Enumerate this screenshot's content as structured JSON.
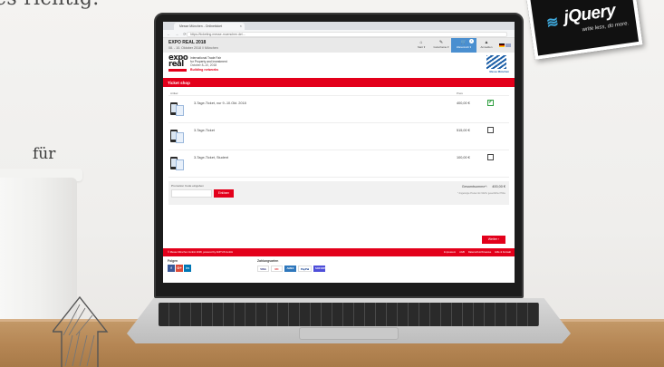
{
  "background": {
    "headline_fragment": "es richtig.",
    "word_fragment": "für"
  },
  "sticker": {
    "name": "jQuery",
    "tagline": "write less, do more."
  },
  "browser": {
    "tab_title": "Messe München - Onlineticket",
    "tab_close": "×",
    "nav_buttons": "← → ⟳ ⌂",
    "url": "https://ticketing.messe-muenchen.de/..."
  },
  "site": {
    "event_title": "EXPO REAL 2018",
    "event_date": "08. - 10. Oktober 2018 // München",
    "nav": [
      {
        "glyph": "⌂",
        "label": "Start ▾"
      },
      {
        "glyph": "✎",
        "label": "Gutscheine ▾"
      },
      {
        "glyph": "🛒",
        "label": "Warenkorb ▾",
        "badge": "1"
      },
      {
        "glyph": "▲",
        "label": "Anmelden"
      }
    ]
  },
  "brand": {
    "logo_line1": "expo",
    "logo_line2": "real",
    "tagline_1": "International Trade Fair",
    "tagline_2": "for Property and Investment",
    "tagline_3": "October 8–10, 2018",
    "tagline_4": "Building networks",
    "mm_label": "Messe München"
  },
  "shop": {
    "section_title": "Ticket shop",
    "col_article": "Artikel",
    "col_price": "Preis",
    "tickets": [
      {
        "name": "3-Tage-Ticket, nur 9.-10.Okt. 2018",
        "price": "400,00 €",
        "checked": true
      },
      {
        "name": "3-Tage-Ticket",
        "price": "515,00 €",
        "checked": false
      },
      {
        "name": "3-Tage-Ticket, Student",
        "price": "100,00 €",
        "checked": false
      }
    ],
    "promo_label": "Promotion Code eingeben",
    "promo_button": "Einlösen",
    "total_label": "Gesamtsumme*:",
    "total_value": "400,00 €",
    "vat_note": "* Angezeigte Preise inkl. MwSt. gesetzlicher Höhe",
    "next_button": "Weiter ›"
  },
  "footer": {
    "copyright": "© Messe München GmbH 2018, powered by ADITUS GmbH",
    "links": [
      "Impressum",
      "AGB",
      "Datenschutzhinweise",
      "Hilfe & Kontakt"
    ],
    "follow_label": "Folgen",
    "social": [
      "f",
      "G+",
      "in"
    ],
    "payment_label": "Zahlungsarten",
    "payments": [
      "VISA",
      "MC",
      "AMEX",
      "PayPal",
      "SOFORT"
    ]
  }
}
